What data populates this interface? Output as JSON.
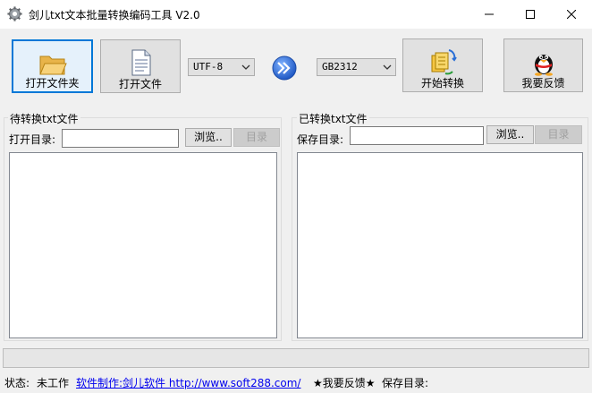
{
  "window": {
    "title": "剑儿txt文本批量转换编码工具 V2.0",
    "icon": "gear-icon",
    "controls": {
      "minimize": "—",
      "maximize": "☐",
      "close": "✕"
    }
  },
  "toolbar": {
    "open_folder_label": "打开文件夹",
    "open_file_label": "打开文件",
    "source_encoding": "UTF-8",
    "target_encoding": "GB2312",
    "start_label": "开始转换",
    "feedback_label": "我要反馈"
  },
  "source_panel": {
    "title": "待转换txt文件",
    "dir_label": "打开目录:",
    "dir_value": "",
    "browse_label": "浏览..",
    "dir_button_label": "目录"
  },
  "target_panel": {
    "title": "已转换txt文件",
    "dir_label": "保存目录:",
    "dir_value": "",
    "browse_label": "浏览..",
    "dir_button_label": "目录"
  },
  "status": {
    "state_label": "状态:",
    "state_value": "未工作",
    "author_link": "软件制作:剑儿软件 http://www.soft288.com/",
    "feedback_text": "★我要反馈★",
    "save_dir_label": "保存目录:"
  },
  "colors": {
    "accent": "#0078d7",
    "link": "#0000ee",
    "arrow_blue": "#2a6fd6"
  }
}
